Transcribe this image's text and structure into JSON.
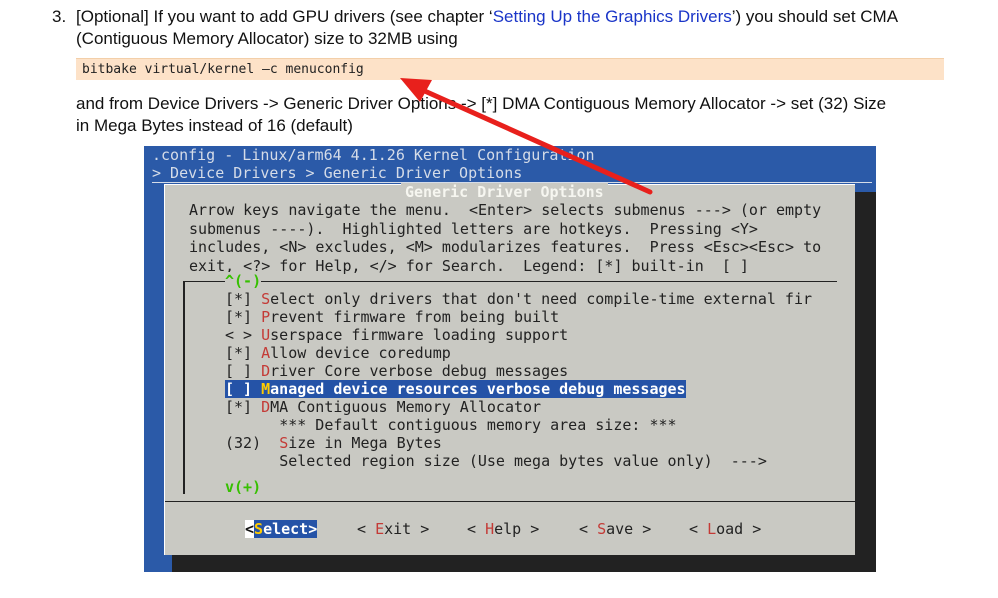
{
  "step": {
    "number": "3.",
    "text_before_link": "[Optional] If you want to add GPU drivers (see chapter ‘",
    "link": "Setting Up the Graphics Drivers",
    "text_after_link": "’) you should set CMA",
    "line2": "(Contiguous Memory Allocator) size to 32MB using"
  },
  "command": "bitbake virtual/kernel –c menuconfig",
  "instructions": {
    "line1": "and from Device Drivers -> Generic Driver Options -> [*] DMA Contiguous Memory Allocator -> set (32) Size",
    "line2": "in Mega Bytes instead of 16 (default)"
  },
  "terminal": {
    "config_title": ".config - Linux/arm64 4.1.26 Kernel Configuration",
    "breadcrumb": "> Device Drivers > Generic Driver Options",
    "dialog_title": "Generic Driver Options",
    "help": [
      "Arrow keys navigate the menu.  <Enter> selects submenus ---> (or empty",
      "submenus ----).  Highlighted letters are hotkeys.  Pressing <Y>",
      "includes, <N> excludes, <M> modularizes features.  Press <Esc><Esc> to",
      "exit, <?> for Help, </> for Search.  Legend: [*] built-in  [ ]"
    ],
    "scroll_up": "^(-)",
    "scroll_down": "v(+)",
    "items": [
      {
        "prefix": "[*] ",
        "hotkey": "S",
        "rest": "elect only drivers that don't need compile-time external fir"
      },
      {
        "prefix": "[*] ",
        "hotkey": "P",
        "rest": "revent firmware from being built"
      },
      {
        "prefix": "< > ",
        "hotkey": "U",
        "rest": "serspace firmware loading support"
      },
      {
        "prefix": "[*] ",
        "hotkey": "A",
        "rest": "llow device coredump"
      },
      {
        "prefix": "[ ] ",
        "hotkey": "D",
        "rest": "river Core verbose debug messages"
      },
      {
        "prefix": "[ ] ",
        "hotkey": "M",
        "rest": "anaged device resources verbose debug messages"
      },
      {
        "prefix": "[*] ",
        "hotkey": "D",
        "rest": "MA Contiguous Memory Allocator"
      },
      {
        "prefix": "      ",
        "hotkey": "",
        "rest": "*** Default contiguous memory area size: ***"
      },
      {
        "prefix": "(32)  ",
        "hotkey": "S",
        "rest": "ize in Mega Bytes"
      },
      {
        "prefix": "      ",
        "hotkey": "",
        "rest": "Selected region size (Use mega bytes value only)  --->"
      }
    ],
    "buttons": {
      "select_l": "<",
      "select_h": "S",
      "select_r": "elect>",
      "exit_l": "< ",
      "exit_h": "E",
      "exit_r": "xit >",
      "help_l": "< ",
      "help_h": "H",
      "help_r": "elp >",
      "save_l": "< ",
      "save_h": "S",
      "save_r": "ave >",
      "load_l": "< ",
      "load_h": "L",
      "load_r": "oad >"
    }
  },
  "colors": {
    "terminal_bg": "#2b5aa8",
    "dialog_bg": "#c9c9c3",
    "arrow": "#e8201c",
    "link": "#1a35c8"
  }
}
